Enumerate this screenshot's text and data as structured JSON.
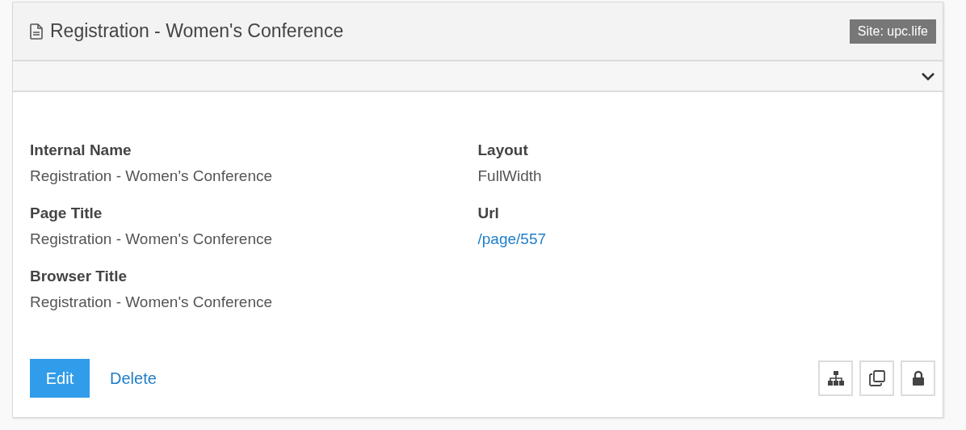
{
  "panel": {
    "title": "Registration - Women's Conference",
    "site_badge": "Site: upc.life"
  },
  "fields": [
    {
      "label": "Internal Name",
      "value": "Registration - Women's Conference",
      "kind": "text"
    },
    {
      "label": "Layout",
      "value": "FullWidth",
      "kind": "text"
    },
    {
      "label": "Page Title",
      "value": "Registration - Women's Conference",
      "kind": "text"
    },
    {
      "label": "Url",
      "value": "/page/557",
      "kind": "link"
    },
    {
      "label": "Browser Title",
      "value": "Registration - Women's Conference",
      "kind": "text"
    }
  ],
  "actions": {
    "primary": "Edit",
    "secondary": "Delete"
  }
}
